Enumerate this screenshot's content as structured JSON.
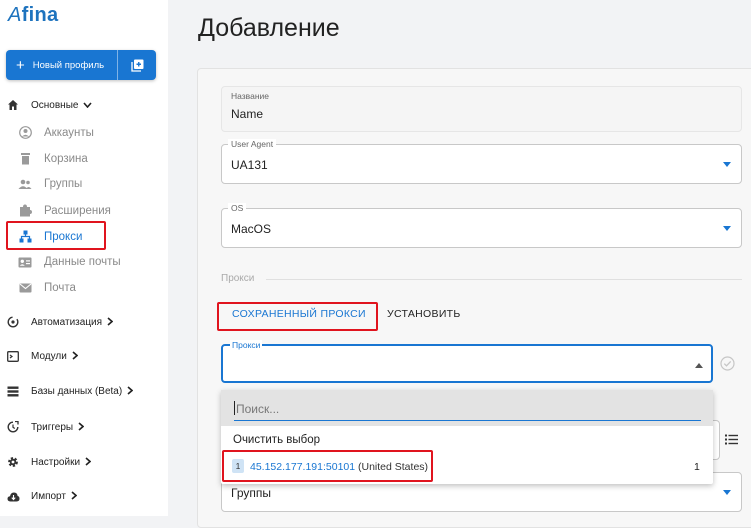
{
  "app": {
    "logo_mark": "A",
    "logo_text": "fina"
  },
  "sidebar": {
    "new_profile_label": "Новый профиль",
    "groups": [
      {
        "label": "Основные",
        "icon": "home-icon"
      },
      {
        "label": "Автоматизация",
        "icon": "automation-icon"
      },
      {
        "label": "Модули",
        "icon": "modules-icon"
      },
      {
        "label": "Базы данных (Beta)",
        "icon": "database-icon"
      },
      {
        "label": "Триггеры",
        "icon": "trigger-icon"
      },
      {
        "label": "Настройки",
        "icon": "settings-icon"
      },
      {
        "label": "Импорт",
        "icon": "import-icon"
      }
    ],
    "items": [
      {
        "label": "Аккаунты",
        "icon": "account-icon"
      },
      {
        "label": "Корзина",
        "icon": "trash-icon"
      },
      {
        "label": "Группы",
        "icon": "groups-icon"
      },
      {
        "label": "Расширения",
        "icon": "puzzle-icon"
      },
      {
        "label": "Прокси",
        "icon": "network-icon",
        "active": true
      },
      {
        "label": "Данные почты",
        "icon": "mail-data-icon"
      },
      {
        "label": "Почта",
        "icon": "mail-icon"
      }
    ]
  },
  "main": {
    "title": "Добавление",
    "form": {
      "name_label": "Название",
      "name_value": "Name",
      "useragent_label": "User Agent",
      "useragent_value": "UA131",
      "os_label": "OS",
      "os_value": "MacOS",
      "proxy_section_label": "Прокси",
      "tabs": [
        "СОХРАНЕННЫЙ ПРОКСИ",
        "УСТАНОВИТЬ"
      ],
      "proxy_label": "Прокси",
      "groups_value": "Группы"
    },
    "dropdown": {
      "search_placeholder": "Поиск...",
      "clear_label": "Очистить выбор",
      "options": [
        {
          "index": "1",
          "ip": "45.152.177.191:50101",
          "country": "(United States)",
          "count": "1"
        }
      ]
    }
  },
  "colors": {
    "accent": "#1976d2",
    "highlight": "#e0141e"
  }
}
